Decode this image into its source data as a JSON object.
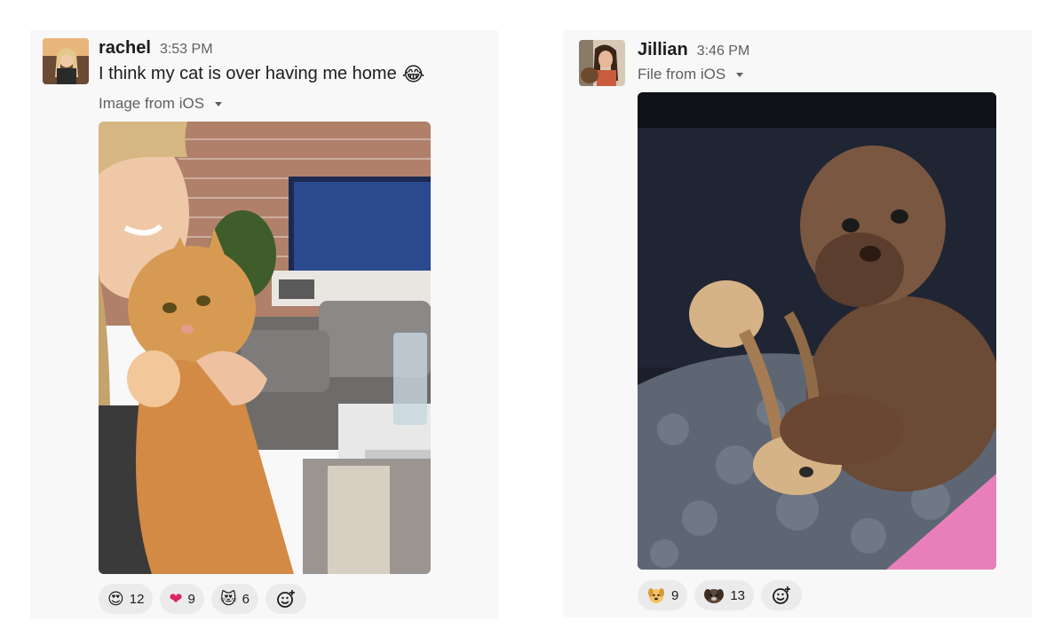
{
  "messages": [
    {
      "author": "rachel",
      "time": "3:53 PM",
      "text": "I think my cat is over having me home",
      "text_emoji_icon": "laughing-tears-emoji-icon",
      "file_label": "Image from iOS",
      "reactions": [
        {
          "emoji": "heart-eyes-emoji-icon",
          "glyph": "😍",
          "count": "12"
        },
        {
          "emoji": "red-heart-emoji-icon",
          "glyph": "❤️",
          "count": "9"
        },
        {
          "emoji": "heart-eyes-cat-emoji-icon",
          "glyph": "😻",
          "count": "6"
        }
      ]
    },
    {
      "author": "Jillian",
      "time": "3:46 PM",
      "file_label": "File from iOS",
      "reactions": [
        {
          "emoji": "dog-custom-emoji-icon",
          "count": "9"
        },
        {
          "emoji": "dog-photo-custom-emoji-icon",
          "count": "13"
        }
      ]
    }
  ],
  "colors": {
    "card_bg": "#f8f8f8",
    "reaction_bg": "#ebebeb",
    "text_primary": "#1d1c1d",
    "text_secondary": "#616061"
  }
}
